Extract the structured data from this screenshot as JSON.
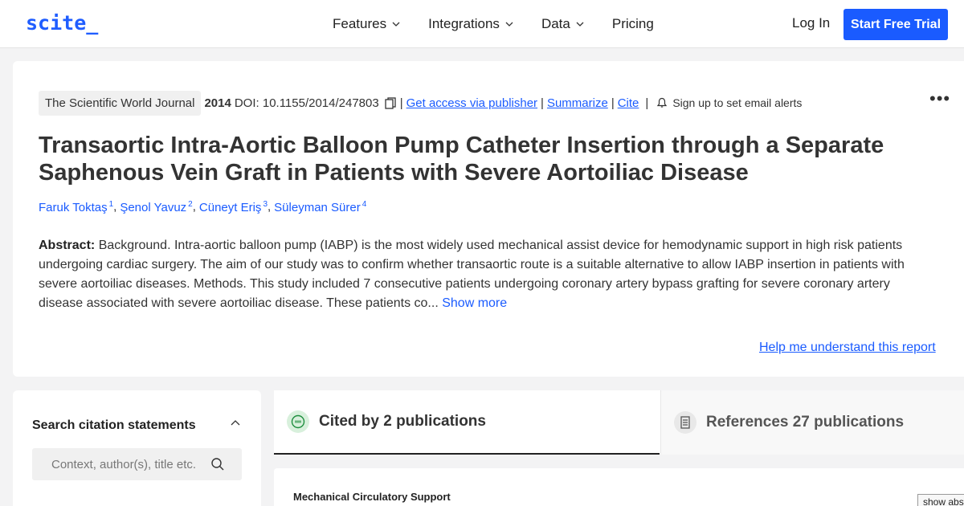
{
  "nav": {
    "logo": "scite_",
    "links": [
      {
        "label": "Features",
        "has_dropdown": true
      },
      {
        "label": "Integrations",
        "has_dropdown": true
      },
      {
        "label": "Data",
        "has_dropdown": true
      },
      {
        "label": "Pricing",
        "has_dropdown": false
      }
    ],
    "login": "Log In",
    "cta": "Start Free Trial",
    "brand_color": "#1a5bff"
  },
  "paper": {
    "journal": "The Scientific World Journal",
    "year": "2014",
    "doi": "DOI: 10.1155/2014/247803",
    "links": {
      "access": "Get access via publisher",
      "summarize": "Summarize",
      "cite": "Cite"
    },
    "separator": "|",
    "alerts": "Sign up to set email alerts",
    "more": "•••",
    "title": "Transaortic Intra-Aortic Balloon Pump Catheter Insertion through a Separate Saphenous Vein Graft in Patients with Severe Aortoiliac Disease",
    "authors": [
      {
        "name": "Faruk Toktaş",
        "sup": "1"
      },
      {
        "name": "Şenol Yavuz",
        "sup": "2"
      },
      {
        "name": "Cüneyt Eriş",
        "sup": "3"
      },
      {
        "name": "Süleyman Sürer",
        "sup": "4"
      }
    ],
    "author_separator": ",",
    "abstract_label": "Abstract:",
    "abstract_text": "Background. Intra-aortic balloon pump (IABP) is the most widely used mechanical assist device for hemodynamic support in high risk patients undergoing cardiac surgery. The aim of our study was to confirm whether transaortic route is a suitable alternative to allow IABP insertion in patients with severe aortoiliac diseases. Methods. This study included 7 consecutive patients undergoing coronary artery bypass grafting for severe coronary artery disease associated with severe aortoiliac disease. These patients co...",
    "show_more": "Show more",
    "help": "Help me understand this report"
  },
  "search": {
    "heading": "Search citation statements",
    "placeholder": "Context, author(s), title etc."
  },
  "tabs": [
    {
      "label": "Cited by 2 publications",
      "active": true
    },
    {
      "label": "References 27 publications",
      "active": false
    }
  ],
  "results": {
    "heading": "Mechanical Circulatory Support",
    "show_abstract_button": "show abstract"
  }
}
